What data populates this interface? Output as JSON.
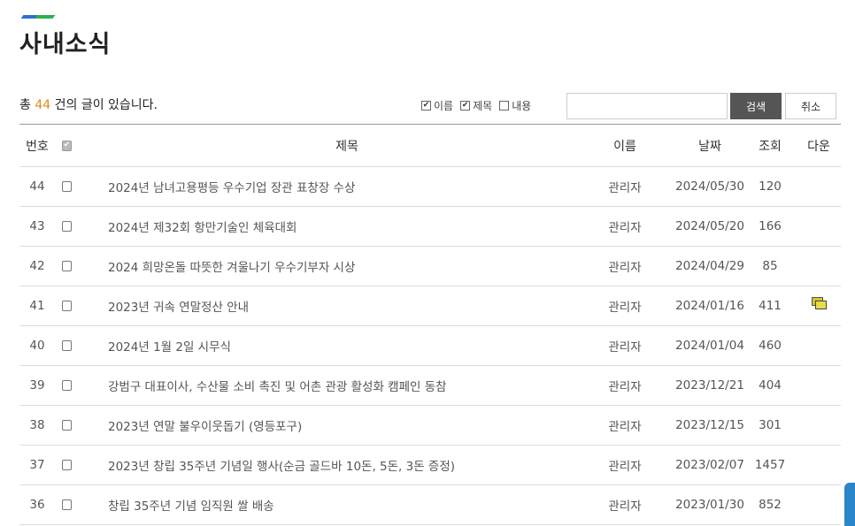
{
  "page": {
    "title": "사내소식",
    "summary_prefix": "총 ",
    "summary_count": "44",
    "summary_suffix": " 건의 글이 있습니다."
  },
  "search": {
    "options": [
      {
        "label": "이름",
        "checked": true
      },
      {
        "label": "제목",
        "checked": true
      },
      {
        "label": "내용",
        "checked": false
      }
    ],
    "value": "",
    "search_label": "검색",
    "cancel_label": "취소"
  },
  "table": {
    "headers": {
      "no": "번호",
      "title": "제목",
      "name": "이름",
      "date": "날짜",
      "views": "조회",
      "download": "다운"
    },
    "rows": [
      {
        "no": "44",
        "title": "2024년 남녀고용평등 우수기업 장관 표창장 수상",
        "name": "관리자",
        "date": "2024/05/30",
        "views": "120",
        "has_file": false
      },
      {
        "no": "43",
        "title": "2024년 제32회 항만기술인 체육대회",
        "name": "관리자",
        "date": "2024/05/20",
        "views": "166",
        "has_file": false
      },
      {
        "no": "42",
        "title": "2024 희망온돌 따뜻한 겨울나기 우수기부자 시상",
        "name": "관리자",
        "date": "2024/04/29",
        "views": "85",
        "has_file": false
      },
      {
        "no": "41",
        "title": "2023년 귀속 연말정산 안내",
        "name": "관리자",
        "date": "2024/01/16",
        "views": "411",
        "has_file": true
      },
      {
        "no": "40",
        "title": "2024년 1월 2일 시무식",
        "name": "관리자",
        "date": "2024/01/04",
        "views": "460",
        "has_file": false
      },
      {
        "no": "39",
        "title": "강범구 대표이사, 수산물 소비 촉진 및 어촌 관광 활성화 캠페인 동참",
        "name": "관리자",
        "date": "2023/12/21",
        "views": "404",
        "has_file": false
      },
      {
        "no": "38",
        "title": "2023년 연말 불우이웃돕기 (영등포구)",
        "name": "관리자",
        "date": "2023/12/15",
        "views": "301",
        "has_file": false
      },
      {
        "no": "37",
        "title": "2023년 창립 35주년 기념일 행사(순금 골드바 10돈, 5돈, 3돈 증정)",
        "name": "관리자",
        "date": "2023/02/07",
        "views": "1457",
        "has_file": false
      },
      {
        "no": "36",
        "title": "창립 35주년 기념 임직원 쌀 배송",
        "name": "관리자",
        "date": "2023/01/30",
        "views": "852",
        "has_file": false
      }
    ]
  },
  "colors": {
    "accent_blue": "#2f6fd0",
    "accent_green": "#2bb24c",
    "count_orange": "#e08a1e",
    "search_button": "#555555"
  },
  "icons": {
    "file": "file-attachment-icon",
    "checkbox": "checkbox-icon"
  }
}
